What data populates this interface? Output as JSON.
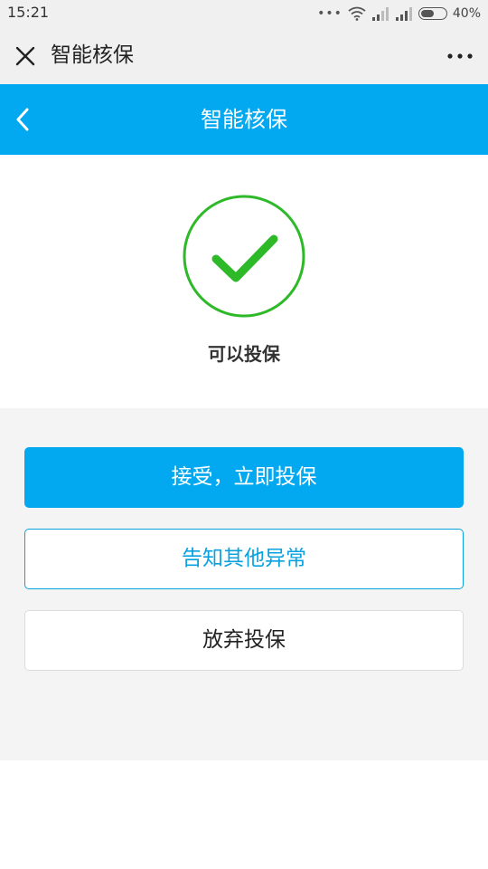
{
  "status_bar": {
    "time": "15:21",
    "battery_percent": "40%",
    "icons": [
      "more-dots-icon",
      "wifi-icon",
      "signal-icon",
      "signal-icon",
      "battery-icon"
    ]
  },
  "app_bar": {
    "title": "智能核保",
    "icons": [
      "close-icon",
      "more-icon"
    ]
  },
  "header": {
    "title": "智能核保",
    "icons": [
      "back-chevron-icon"
    ],
    "background_color": "#03a9f0"
  },
  "result": {
    "label": "可以投保",
    "icon": "check-circle-icon",
    "icon_color": "#2db928"
  },
  "actions": {
    "accept_label": "接受，立即投保",
    "notify_label": "告知其他异常",
    "abandon_label": "放弃投保",
    "primary_color": "#03a9f0"
  }
}
